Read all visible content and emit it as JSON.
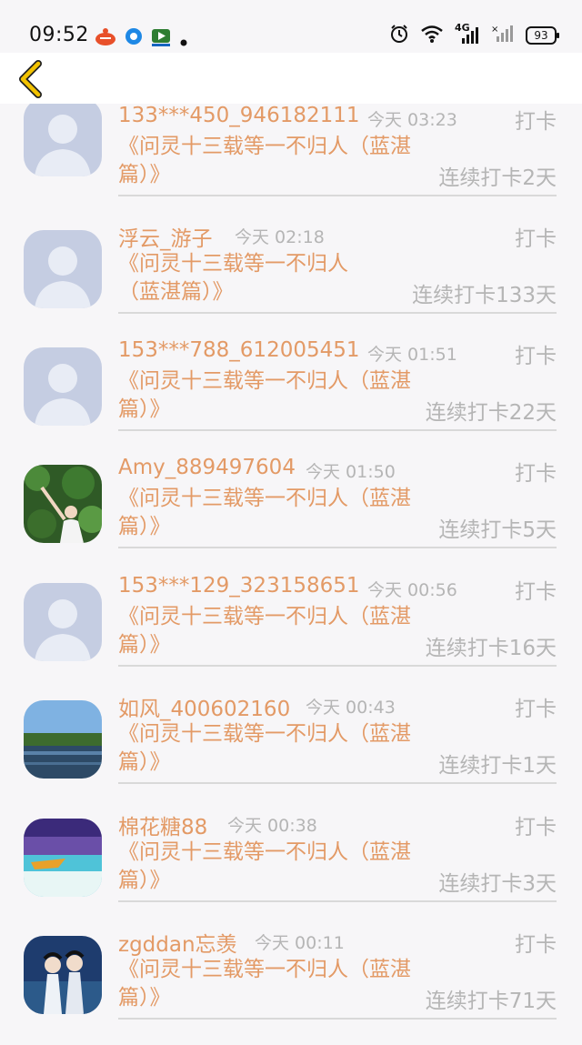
{
  "status_bar": {
    "time": "09:52",
    "battery": "93",
    "network": "4G",
    "icons": [
      "notification-app-icon",
      "browser-icon",
      "video-app-icon",
      "dot-icon",
      "alarm-icon",
      "wifi-icon",
      "signal-4g-icon",
      "signal-icon",
      "battery-icon"
    ]
  },
  "header": {
    "back_icon": "chevron-left-icon",
    "accent": "#f2c200"
  },
  "colors": {
    "name": "#e39a66",
    "meta": "#b5b5b5",
    "divider": "#d9d9d9"
  },
  "entries": [
    {
      "name": "133***450_946182111",
      "time": "今天 03:23",
      "action": "打卡",
      "book": "《问灵十三载等一不归人（蓝湛篇）》",
      "streak": "连续打卡2天",
      "avatar": "default-avatar"
    },
    {
      "name": "浮云_游子",
      "time": "今天 02:18",
      "action": "打卡",
      "book": "《问灵十三载等一不归人（蓝湛篇）》",
      "streak": "连续打卡133天",
      "avatar": "default-avatar"
    },
    {
      "name": "153***788_612005451",
      "time": "今天 01:51",
      "action": "打卡",
      "book": "《问灵十三载等一不归人（蓝湛篇）》",
      "streak": "连续打卡22天",
      "avatar": "default-avatar"
    },
    {
      "name": "Amy_889497604",
      "time": "今天 01:50",
      "action": "打卡",
      "book": "《问灵十三载等一不归人（蓝湛篇）》",
      "streak": "连续打卡5天",
      "avatar": "photo-leaves-avatar"
    },
    {
      "name": "153***129_323158651",
      "time": "今天 00:56",
      "action": "打卡",
      "book": "《问灵十三载等一不归人（蓝湛篇）》",
      "streak": "连续打卡16天",
      "avatar": "default-avatar"
    },
    {
      "name": "如风_400602160",
      "time": "今天 00:43",
      "action": "打卡",
      "book": "《问灵十三载等一不归人（蓝湛篇）》",
      "streak": "连续打卡1天",
      "avatar": "photo-lake-avatar"
    },
    {
      "name": "棉花糖88",
      "time": "今天 00:38",
      "action": "打卡",
      "book": "《问灵十三载等一不归人（蓝湛篇）》",
      "streak": "连续打卡3天",
      "avatar": "photo-boat-avatar"
    },
    {
      "name": "zgddan忘羡",
      "time": "今天 00:11",
      "action": "打卡",
      "book": "《问灵十三载等一不归人（蓝湛篇）》",
      "streak": "连续打卡71天",
      "avatar": "photo-drama-avatar"
    }
  ]
}
